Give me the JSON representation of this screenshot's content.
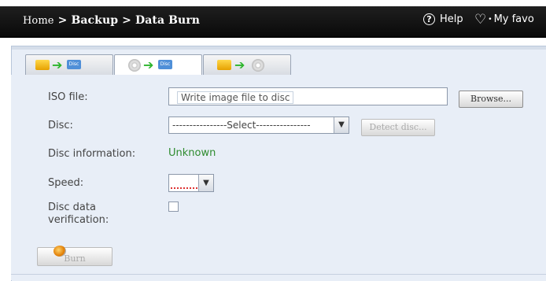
{
  "header": {
    "breadcrumb": [
      "Home",
      "Backup",
      "Data Burn"
    ],
    "separator": ">",
    "help_label": "Help",
    "favorite_label": "My favo"
  },
  "tabs": [
    {
      "name": "image-to-disc",
      "active": false
    },
    {
      "name": "disc-to-disc",
      "active": true
    },
    {
      "name": "data-to-disc",
      "active": false
    }
  ],
  "icons": {
    "disc_tag": "Disc"
  },
  "form": {
    "iso_label": "ISO file:",
    "iso_placeholder": "Write image file to disc",
    "browse_button": "Browse...",
    "disc_label": "Disc:",
    "disc_select_value": "----------------Select----------------",
    "detect_button": "Detect disc...",
    "disc_info_label": "Disc information:",
    "disc_info_value": "Unknown",
    "speed_label": "Speed:",
    "verification_label_line1": "Disc data",
    "verification_label_line2": "verification:",
    "verification_checked": false,
    "burn_button": "Burn"
  },
  "colors": {
    "topbar": "#111111",
    "panel_bg": "#e8eef7",
    "disc_info_value": "#2e8b2e",
    "arrow": "#2db52d"
  }
}
